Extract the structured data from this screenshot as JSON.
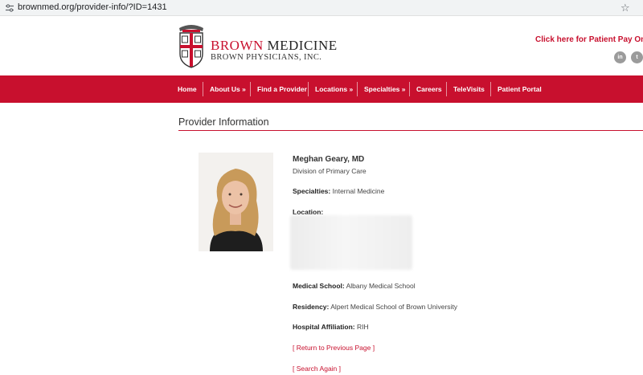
{
  "browser": {
    "url": "brownmed.org/provider-info/?ID=1431"
  },
  "header": {
    "brand_line1_red": "BROWN",
    "brand_line1_rest": "MEDICINE",
    "brand_line2": "BROWN PHYSICIANS, INC.",
    "pay_link": "Click here for Patient Pay Online",
    "social": {
      "linkedin": "in",
      "twitter": "t"
    }
  },
  "nav": {
    "items": [
      "Home",
      "About Us »",
      "Find a Provider",
      "Locations »",
      "Specialties »",
      "Careers",
      "TeleVisits",
      "Patient Portal"
    ]
  },
  "page": {
    "section_title": "Provider Information",
    "provider": {
      "name": "Meghan Geary, MD",
      "division": "Division of Primary Care",
      "specialties_label": "Specialties:",
      "specialties": "Internal Medicine",
      "location_label": "Location:",
      "medical_school_label": "Medical School:",
      "medical_school": "Albany Medical School",
      "residency_label": "Residency:",
      "residency": "Alpert Medical School of Brown University",
      "affiliation_label": "Hospital Affiliation:",
      "affiliation": "RIH"
    },
    "links": {
      "return": "[ Return to Previous Page ]",
      "search": "[ Search Again ]"
    }
  },
  "colors": {
    "brand_red": "#c8102e"
  }
}
